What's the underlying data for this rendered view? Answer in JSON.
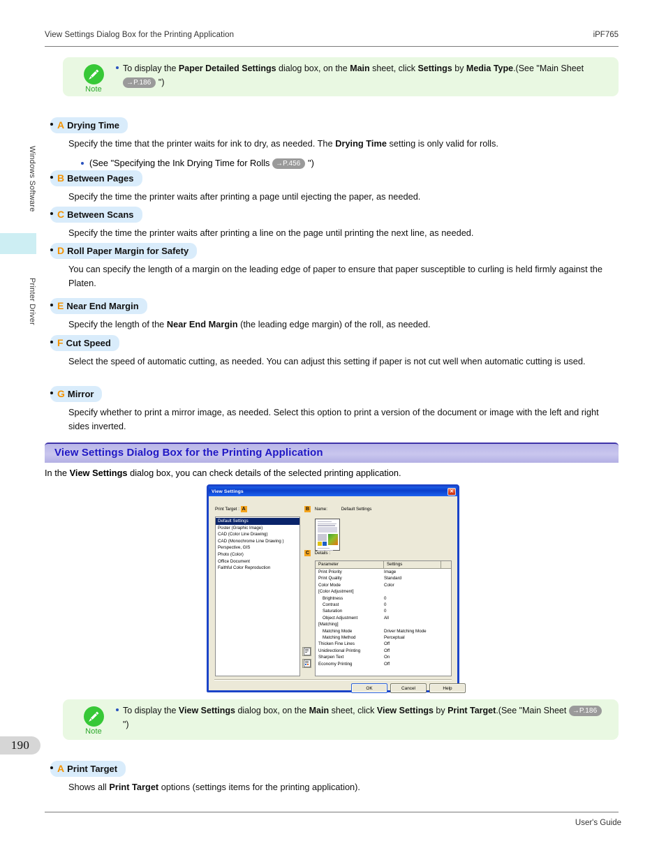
{
  "header": {
    "left": "View Settings Dialog Box for the Printing Application",
    "right": "iPF765"
  },
  "footer": {
    "right": "User's Guide"
  },
  "sidebar": {
    "label_top": "Windows Software",
    "label_bottom": "Printer Driver",
    "page_number": "190"
  },
  "note_top": {
    "word": "Note",
    "text_1": "To display the ",
    "b_1": "Paper Detailed Settings",
    "text_2": " dialog box, on the ",
    "b_2": "Main",
    "text_3": " sheet, click ",
    "b_3": "Settings",
    "text_4": " by ",
    "b_4": "Media Type",
    "text_5": ".(See \"Main Sheet ",
    "ref": "→P.186",
    "text_6": " \")"
  },
  "items": [
    {
      "letter": "A",
      "title": "Drying Time",
      "body_1": "Specify the time that the printer waits for ink to dry, as needed. The ",
      "body_b": "Drying Time",
      "body_2": " setting is only valid for rolls.",
      "sub_1": "(See \"Specifying the Ink Drying Time for Rolls ",
      "sub_ref": "→P.456",
      "sub_2": " \")"
    },
    {
      "letter": "B",
      "title": "Between Pages",
      "body_1": "Specify the time the printer waits after printing a page until ejecting the paper, as needed.",
      "body_b": "",
      "body_2": ""
    },
    {
      "letter": "C",
      "title": "Between Scans",
      "body_1": "Specify the time the printer waits after printing a line on the page until printing the next line, as needed.",
      "body_b": "",
      "body_2": ""
    },
    {
      "letter": "D",
      "title": "Roll Paper Margin for Safety",
      "body_1": "You can specify the length of a margin on the leading edge of paper to ensure that paper susceptible to curling is held firmly against the Platen.",
      "body_b": "",
      "body_2": ""
    },
    {
      "letter": "E",
      "title": "Near End Margin",
      "body_1": "Specify the length of the ",
      "body_b": "Near End Margin",
      "body_2": " (the leading edge margin) of the roll, as needed."
    },
    {
      "letter": "F",
      "title": "Cut Speed",
      "body_1": "Select the speed of automatic cutting, as needed. You can adjust this setting if paper is not cut well when automatic cutting is used.",
      "body_b": "",
      "body_2": ""
    },
    {
      "letter": "G",
      "title": "Mirror",
      "body_1": "Specify whether to print a mirror image, as needed. Select this option to print a version of the document or image with the left and right sides inverted.",
      "body_b": "",
      "body_2": ""
    }
  ],
  "section": {
    "heading": "View Settings Dialog Box for the Printing Application",
    "intro_1": "In the ",
    "intro_b": "View Settings",
    "intro_2": " dialog box, you can check details of the selected printing application."
  },
  "dialog": {
    "title": "View Settings",
    "close_glyph": "✕",
    "print_target_label": "Print Target :",
    "mark_a": "A",
    "mark_b": "B",
    "mark_c": "C",
    "name_label": "Name:",
    "name_value": "Default Settings",
    "details_label": "Details :",
    "list": [
      "Default Settings",
      "Poster (Graphic Image)",
      "CAD (Color Line Drawing)",
      "CAD (Monochrome Line Drawing )",
      "Perspective, GIS",
      "Photo (Color)",
      "Office Document",
      "Faithful Color Reproduction"
    ],
    "list_selected_index": 0,
    "table_headers": [
      "Parameter",
      "Settings",
      ""
    ],
    "table_rows": [
      {
        "parameter": "Print Priority",
        "value": "Image",
        "indent": false
      },
      {
        "parameter": "Print Quality",
        "value": "Standard",
        "indent": false
      },
      {
        "parameter": "Color Mode",
        "value": "Color",
        "indent": false
      },
      {
        "parameter": "[Color Adjustment]",
        "value": "",
        "indent": false
      },
      {
        "parameter": "Brightness",
        "value": "0",
        "indent": true
      },
      {
        "parameter": "Contrast",
        "value": "0",
        "indent": true
      },
      {
        "parameter": "Saturation",
        "value": "0",
        "indent": true
      },
      {
        "parameter": "Object Adjustment",
        "value": "All",
        "indent": true
      },
      {
        "parameter": "[Matching]",
        "value": "",
        "indent": false
      },
      {
        "parameter": "Matching Mode",
        "value": "Driver Matching Mode",
        "indent": true
      },
      {
        "parameter": "Matching Method",
        "value": "Perceptual",
        "indent": true
      },
      {
        "parameter": "Thicken Fine Lines",
        "value": "Off",
        "indent": false
      },
      {
        "parameter": "Unidirectional Printing",
        "value": "Off",
        "indent": false
      },
      {
        "parameter": "Sharpen Text",
        "value": "On",
        "indent": false
      },
      {
        "parameter": "Economy Printing",
        "value": "Off",
        "indent": false
      }
    ],
    "buttons": {
      "ok": "OK",
      "cancel": "Cancel",
      "help": "Help"
    }
  },
  "note_bottom": {
    "word": "Note",
    "text_1": "To display the ",
    "b_1": "View Settings",
    "text_2": " dialog box, on the ",
    "b_2": "Main",
    "text_3": " sheet, click ",
    "b_3": "View Settings",
    "text_4": " by ",
    "b_4": "Print Target",
    "text_5": ".(See \"Main Sheet ",
    "ref": "→P.186",
    "text_6": " \")"
  },
  "final_item": {
    "letter": "A",
    "title": "Print Target",
    "body_1": "Shows all ",
    "body_b": "Print Target",
    "body_2": " options (settings items for the printing application)."
  },
  "colors": {
    "accent_letter": "#f39200",
    "item_head_bg": "#d9ecfb",
    "note_bg": "#e9f8e2",
    "note_green": "#2aa82a",
    "section_text": "#1f17c4",
    "dialog_title_blue": "#0a3ecb",
    "marker_orange": "#f5a51e",
    "sidebar_tab": "#cdeef3"
  }
}
